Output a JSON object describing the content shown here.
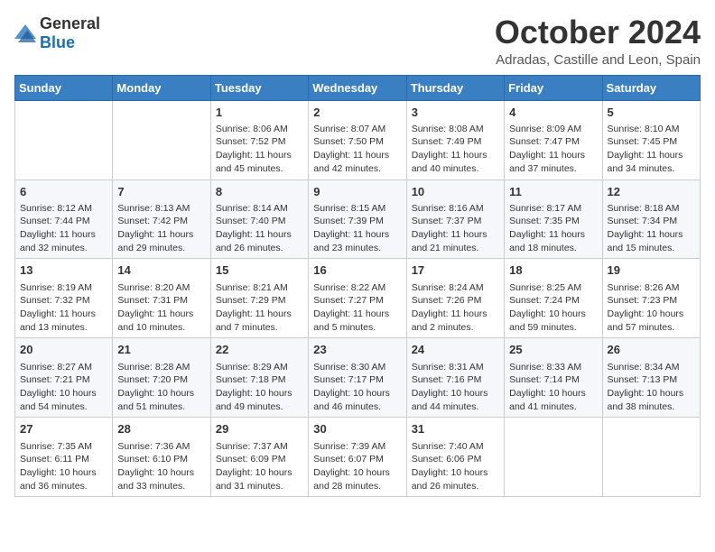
{
  "logo": {
    "general": "General",
    "blue": "Blue"
  },
  "title": "October 2024",
  "location": "Adradas, Castille and Leon, Spain",
  "days_header": [
    "Sunday",
    "Monday",
    "Tuesday",
    "Wednesday",
    "Thursday",
    "Friday",
    "Saturday"
  ],
  "weeks": [
    [
      {
        "day": "",
        "info": ""
      },
      {
        "day": "",
        "info": ""
      },
      {
        "day": "1",
        "info": "Sunrise: 8:06 AM\nSunset: 7:52 PM\nDaylight: 11 hours and 45 minutes."
      },
      {
        "day": "2",
        "info": "Sunrise: 8:07 AM\nSunset: 7:50 PM\nDaylight: 11 hours and 42 minutes."
      },
      {
        "day": "3",
        "info": "Sunrise: 8:08 AM\nSunset: 7:49 PM\nDaylight: 11 hours and 40 minutes."
      },
      {
        "day": "4",
        "info": "Sunrise: 8:09 AM\nSunset: 7:47 PM\nDaylight: 11 hours and 37 minutes."
      },
      {
        "day": "5",
        "info": "Sunrise: 8:10 AM\nSunset: 7:45 PM\nDaylight: 11 hours and 34 minutes."
      }
    ],
    [
      {
        "day": "6",
        "info": "Sunrise: 8:12 AM\nSunset: 7:44 PM\nDaylight: 11 hours and 32 minutes."
      },
      {
        "day": "7",
        "info": "Sunrise: 8:13 AM\nSunset: 7:42 PM\nDaylight: 11 hours and 29 minutes."
      },
      {
        "day": "8",
        "info": "Sunrise: 8:14 AM\nSunset: 7:40 PM\nDaylight: 11 hours and 26 minutes."
      },
      {
        "day": "9",
        "info": "Sunrise: 8:15 AM\nSunset: 7:39 PM\nDaylight: 11 hours and 23 minutes."
      },
      {
        "day": "10",
        "info": "Sunrise: 8:16 AM\nSunset: 7:37 PM\nDaylight: 11 hours and 21 minutes."
      },
      {
        "day": "11",
        "info": "Sunrise: 8:17 AM\nSunset: 7:35 PM\nDaylight: 11 hours and 18 minutes."
      },
      {
        "day": "12",
        "info": "Sunrise: 8:18 AM\nSunset: 7:34 PM\nDaylight: 11 hours and 15 minutes."
      }
    ],
    [
      {
        "day": "13",
        "info": "Sunrise: 8:19 AM\nSunset: 7:32 PM\nDaylight: 11 hours and 13 minutes."
      },
      {
        "day": "14",
        "info": "Sunrise: 8:20 AM\nSunset: 7:31 PM\nDaylight: 11 hours and 10 minutes."
      },
      {
        "day": "15",
        "info": "Sunrise: 8:21 AM\nSunset: 7:29 PM\nDaylight: 11 hours and 7 minutes."
      },
      {
        "day": "16",
        "info": "Sunrise: 8:22 AM\nSunset: 7:27 PM\nDaylight: 11 hours and 5 minutes."
      },
      {
        "day": "17",
        "info": "Sunrise: 8:24 AM\nSunset: 7:26 PM\nDaylight: 11 hours and 2 minutes."
      },
      {
        "day": "18",
        "info": "Sunrise: 8:25 AM\nSunset: 7:24 PM\nDaylight: 10 hours and 59 minutes."
      },
      {
        "day": "19",
        "info": "Sunrise: 8:26 AM\nSunset: 7:23 PM\nDaylight: 10 hours and 57 minutes."
      }
    ],
    [
      {
        "day": "20",
        "info": "Sunrise: 8:27 AM\nSunset: 7:21 PM\nDaylight: 10 hours and 54 minutes."
      },
      {
        "day": "21",
        "info": "Sunrise: 8:28 AM\nSunset: 7:20 PM\nDaylight: 10 hours and 51 minutes."
      },
      {
        "day": "22",
        "info": "Sunrise: 8:29 AM\nSunset: 7:18 PM\nDaylight: 10 hours and 49 minutes."
      },
      {
        "day": "23",
        "info": "Sunrise: 8:30 AM\nSunset: 7:17 PM\nDaylight: 10 hours and 46 minutes."
      },
      {
        "day": "24",
        "info": "Sunrise: 8:31 AM\nSunset: 7:16 PM\nDaylight: 10 hours and 44 minutes."
      },
      {
        "day": "25",
        "info": "Sunrise: 8:33 AM\nSunset: 7:14 PM\nDaylight: 10 hours and 41 minutes."
      },
      {
        "day": "26",
        "info": "Sunrise: 8:34 AM\nSunset: 7:13 PM\nDaylight: 10 hours and 38 minutes."
      }
    ],
    [
      {
        "day": "27",
        "info": "Sunrise: 7:35 AM\nSunset: 6:11 PM\nDaylight: 10 hours and 36 minutes."
      },
      {
        "day": "28",
        "info": "Sunrise: 7:36 AM\nSunset: 6:10 PM\nDaylight: 10 hours and 33 minutes."
      },
      {
        "day": "29",
        "info": "Sunrise: 7:37 AM\nSunset: 6:09 PM\nDaylight: 10 hours and 31 minutes."
      },
      {
        "day": "30",
        "info": "Sunrise: 7:39 AM\nSunset: 6:07 PM\nDaylight: 10 hours and 28 minutes."
      },
      {
        "day": "31",
        "info": "Sunrise: 7:40 AM\nSunset: 6:06 PM\nDaylight: 10 hours and 26 minutes."
      },
      {
        "day": "",
        "info": ""
      },
      {
        "day": "",
        "info": ""
      }
    ]
  ]
}
